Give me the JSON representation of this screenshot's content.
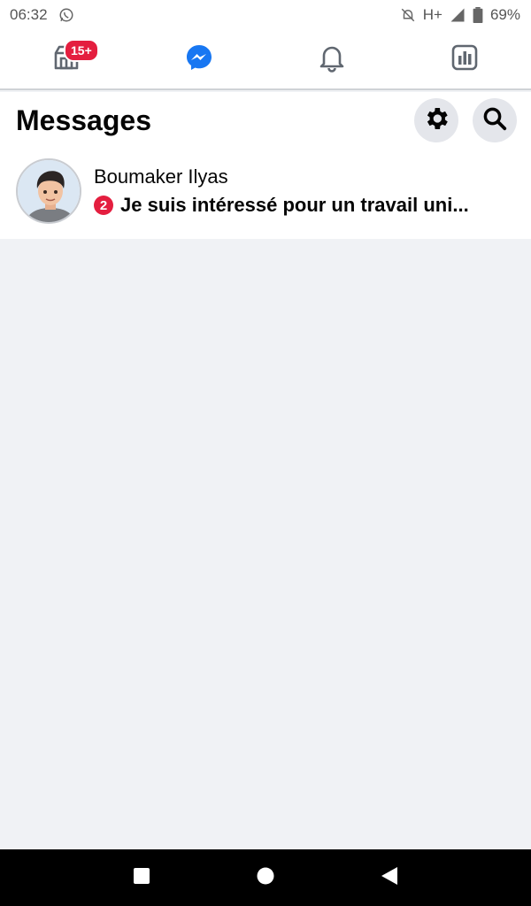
{
  "status_bar": {
    "time": "06:32",
    "network": "H+",
    "battery": "69%",
    "icons": [
      "whatsapp-icon",
      "mute-notifications-icon",
      "signal-icon",
      "battery-icon"
    ]
  },
  "top_nav": {
    "tabs": [
      {
        "name": "home",
        "icon": "storefront-icon",
        "badge": "15+"
      },
      {
        "name": "messenger",
        "icon": "messenger-icon",
        "active": true
      },
      {
        "name": "notifications",
        "icon": "bell-icon"
      },
      {
        "name": "insights",
        "icon": "bar-chart-icon"
      }
    ],
    "accent": "#1877f2"
  },
  "header": {
    "title": "Messages",
    "actions": [
      "gear-icon",
      "search-icon"
    ]
  },
  "conversations": [
    {
      "name": "Boumaker Ilyas",
      "unread_count": "2",
      "preview": "Je suis intéressé pour un travail uni..."
    }
  ],
  "android_nav": {
    "buttons": [
      "recents-button",
      "home-button",
      "back-button"
    ]
  }
}
